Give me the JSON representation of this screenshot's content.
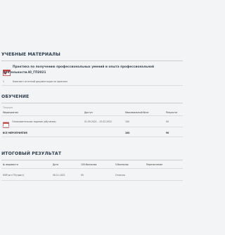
{
  "materials": {
    "title": "УЧЕБНЫЕ МАТЕРИАЛЫ",
    "item_title_line1": "Практика по получению профессиональных умений и опыта профессиональной",
    "item_title_line2": "деятельности.Ю_ГП2021",
    "item_number": "1",
    "item_subtitle": "Комплект отчетной документации по практике"
  },
  "training": {
    "title": "ОБУЧЕНИЕ",
    "filter_label": "Текущее",
    "columns": [
      "Мероприятия",
      "Доступ",
      "Максимальный балл",
      "Результат"
    ],
    "row": {
      "name": "Ознакомительное задание (обучение)",
      "access": "01.09.2021 – 15.02.2022",
      "max": "100",
      "result": "90"
    },
    "total": {
      "label": "ВСЕ МЕРОПРИЯТИЯ",
      "max": "100",
      "result": "90"
    }
  },
  "final": {
    "title": "ИТОГОВЫЙ РЕЗУЛЬТАТ",
    "columns": [
      "№ ведомости",
      "Дата",
      "100-балльная",
      "5-балльная",
      "Перезачтение"
    ],
    "row": {
      "doc": "НИР-ост-ГП(практ)",
      "date": "06.11.2021",
      "score100": "90",
      "score5": "Отлично",
      "credit": ""
    }
  }
}
